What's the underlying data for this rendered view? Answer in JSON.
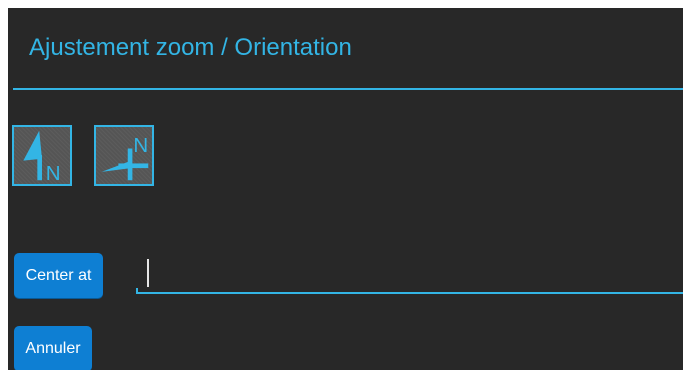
{
  "dialog": {
    "title": "Ajustement zoom / Orientation",
    "accent_color": "#33b5e5",
    "background_color": "#282828"
  },
  "orientation_buttons": [
    {
      "icon": "north-up-arrow-icon",
      "letter": "N"
    },
    {
      "icon": "heading-up-arrow-icon",
      "letter": "N"
    }
  ],
  "center_at": {
    "button_label": "Center at",
    "input_value": "",
    "input_placeholder": ""
  },
  "cancel_button_label": "Annuler",
  "button_color": "#0e7fd3"
}
